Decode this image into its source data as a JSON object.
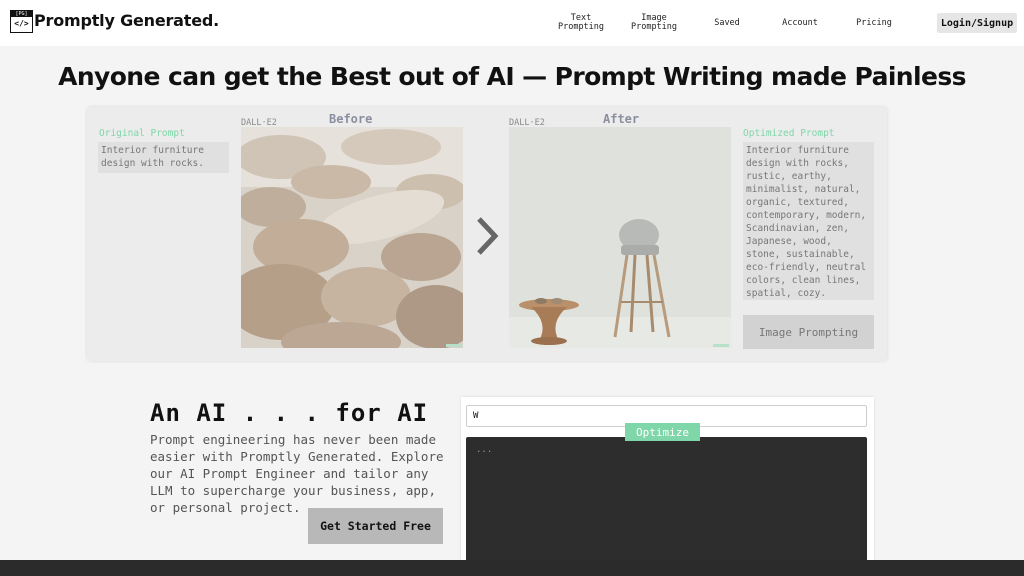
{
  "header": {
    "logo_mark": "[PG]",
    "logo_code": "</>",
    "brand": "Promptly Generated.",
    "nav": [
      {
        "label": "Text\nPrompting"
      },
      {
        "label": "Image\nPrompting"
      },
      {
        "label": "Saved"
      },
      {
        "label": "Account"
      },
      {
        "label": "Pricing"
      }
    ],
    "login_label": "Login/Signup"
  },
  "hero": {
    "headline": "Anyone can get the Best out of AI — Prompt Writing made Painless"
  },
  "demo": {
    "original_label": "Original Prompt",
    "original_text": "Interior furniture design with rocks.",
    "before_model": "DALL·E2",
    "before_label": "Before",
    "after_model": "DALL·E2",
    "after_label": "After",
    "optimized_label": "Optimized Prompt",
    "optimized_text": "Interior furniture design with rocks, rustic, earthy, minimalist, natural, organic, textured, contemporary, modern, Scandinavian, zen, Japanese, wood, stone, sustainable, eco-friendly, neutral colors, clean lines, spatial, cozy.",
    "image_prompting_button": "Image Prompting",
    "accent_color": "#7fd6a8"
  },
  "promo": {
    "title": "An AI . . . for AI",
    "text": "Prompt engineering has never been made easier with Promptly Generated. Explore our AI Prompt Engineer and tailor any LLM to supercharge your business, app, or personal project.",
    "cta_label": "Get Started Free"
  },
  "optimizer": {
    "input_value": "W",
    "optimize_label": "Optimize",
    "output_placeholder": "..."
  },
  "icons": {
    "arrow": "chevron-right-icon"
  }
}
